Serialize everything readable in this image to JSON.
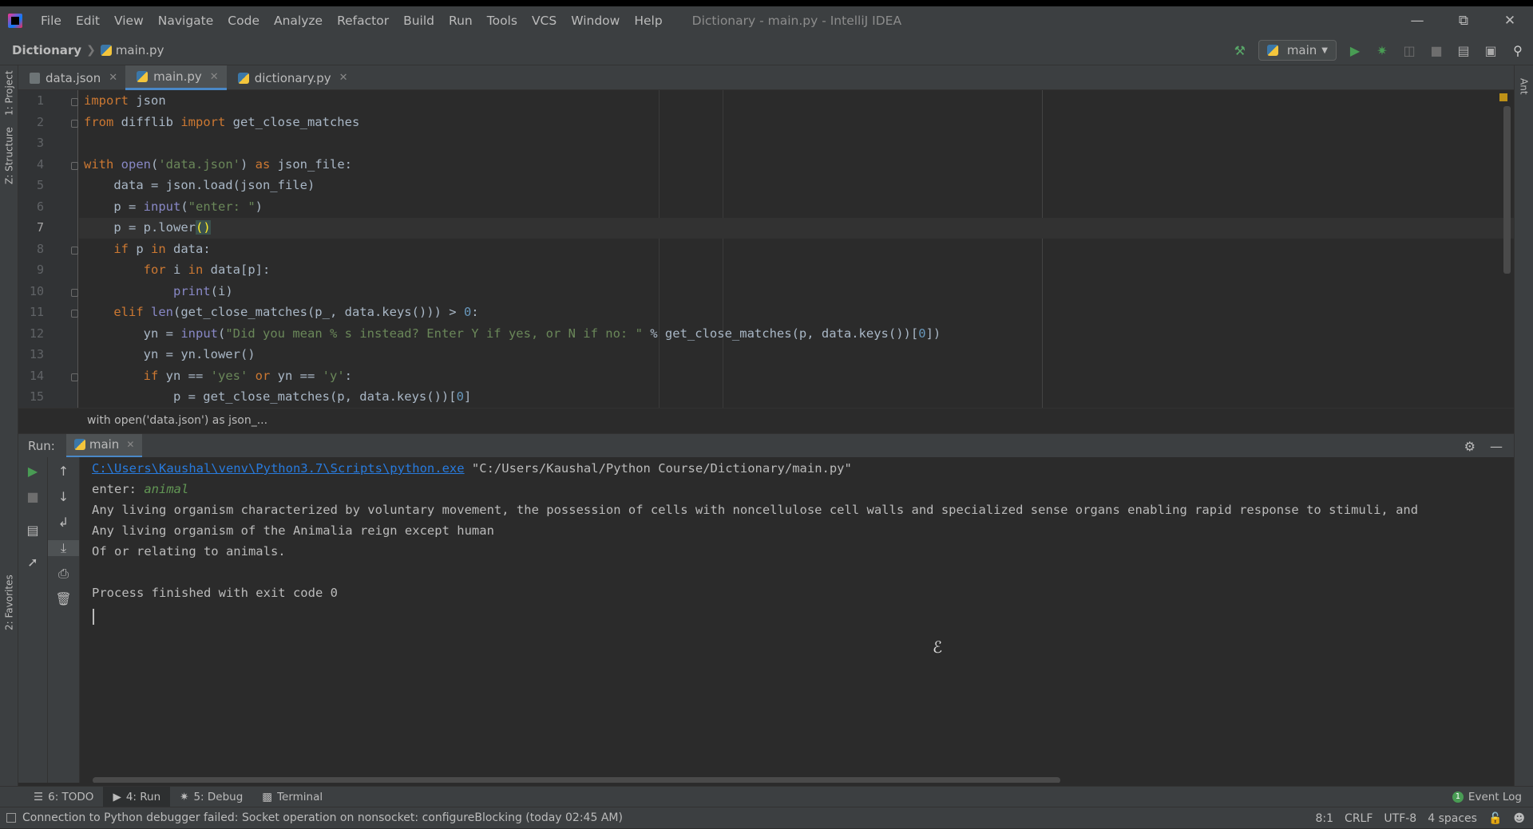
{
  "app": {
    "menu": [
      "File",
      "Edit",
      "View",
      "Navigate",
      "Code",
      "Analyze",
      "Refactor",
      "Build",
      "Run",
      "Tools",
      "VCS",
      "Window",
      "Help"
    ],
    "window_title": "Dictionary - main.py - IntelliJ IDEA"
  },
  "navbar": {
    "project": "Dictionary",
    "file": "main.py",
    "run_config": "main"
  },
  "left_strip": {
    "project": "1: Project",
    "structure": "Z: Structure",
    "favorites": "2: Favorites"
  },
  "right_strip": {
    "ant": "Ant"
  },
  "editor_tabs": [
    {
      "label": "data.json",
      "active": false
    },
    {
      "label": "main.py",
      "active": true
    },
    {
      "label": "dictionary.py",
      "active": false
    }
  ],
  "editor": {
    "current_line": 7,
    "lines": [
      {
        "n": "1",
        "html": "<span class='kw'>import</span> json"
      },
      {
        "n": "2",
        "html": "<span class='kw'>from</span> difflib <span class='kw'>import</span> get_close_matches"
      },
      {
        "n": "3",
        "html": ""
      },
      {
        "n": "4",
        "html": "<span class='kw'>with</span> <span class='bi'>open</span>(<span class='str'>'data.json'</span>) <span class='kw'>as</span> json_file:"
      },
      {
        "n": "5",
        "html": "    data = json.load(json_file)"
      },
      {
        "n": "6",
        "html": "    p = <span class='bi'>input</span>(<span class='str'>\"enter: \"</span>)"
      },
      {
        "n": "7",
        "html": "    p = p.lower<span style='background:#3b514d;color:#ffef28'>()</span>"
      },
      {
        "n": "8",
        "html": "    <span class='kw'>if</span> p <span class='kw'>in</span> data:"
      },
      {
        "n": "9",
        "html": "        <span class='kw'>for</span> i <span class='kw'>in</span> data[p]:"
      },
      {
        "n": "10",
        "html": "            <span class='bi'>print</span>(i)"
      },
      {
        "n": "11",
        "html": "    <span class='kw'>elif</span> <span class='bi'>len</span>(get_close_matches(p_, data.keys())) &gt; <span class='num'>0</span>:"
      },
      {
        "n": "12",
        "html": "        yn = <span class='bi'>input</span>(<span class='str'>\"Did you mean % s instead? Enter Y if yes, or N if no: \"</span> % get_close_matches(p, data.keys())[<span class='num'>0</span>])"
      },
      {
        "n": "13",
        "html": "        yn = yn.lower()"
      },
      {
        "n": "14",
        "html": "        <span class='kw'>if</span> yn == <span class='str'>'yes'</span> <span class='kw'>or</span> yn == <span class='str'>'y'</span>:"
      },
      {
        "n": "15",
        "html": "            p = get_close_matches(p, data.keys())[<span class='num'>0</span>]"
      }
    ],
    "breadcrumb": "with open('data.json') as json_..."
  },
  "run_panel": {
    "label": "Run:",
    "tab": "main",
    "interpreter_path": "C:\\Users\\Kaushal\\venv\\Python3.7\\Scripts\\python.exe",
    "script_path": " \"C:/Users/Kaushal/Python Course/Dictionary/main.py\"",
    "prompt": "enter: ",
    "user_input": "animal",
    "output": [
      "Any living organism characterized by voluntary movement, the possession of cells with noncellulose cell walls and specialized sense organs enabling rapid response to stimuli, and",
      "Any living organism of the Animalia reign except human",
      "Of or relating to animals.",
      "",
      "Process finished with exit code 0"
    ]
  },
  "bottom_tabs": [
    {
      "label": "6: TODO",
      "icon": "list-icon"
    },
    {
      "label": "4: Run",
      "icon": "run-icon",
      "active": true
    },
    {
      "label": "5: Debug",
      "icon": "bug-icon"
    },
    {
      "label": "Terminal",
      "icon": "terminal-icon"
    }
  ],
  "event_log": {
    "label": "Event Log",
    "count": "1"
  },
  "status": {
    "message": "Connection to Python debugger failed: Socket operation on nonsocket: configureBlocking (today 02:45 AM)",
    "position": "8:1",
    "line_sep": "CRLF",
    "encoding": "UTF-8",
    "indent": "4 spaces"
  }
}
